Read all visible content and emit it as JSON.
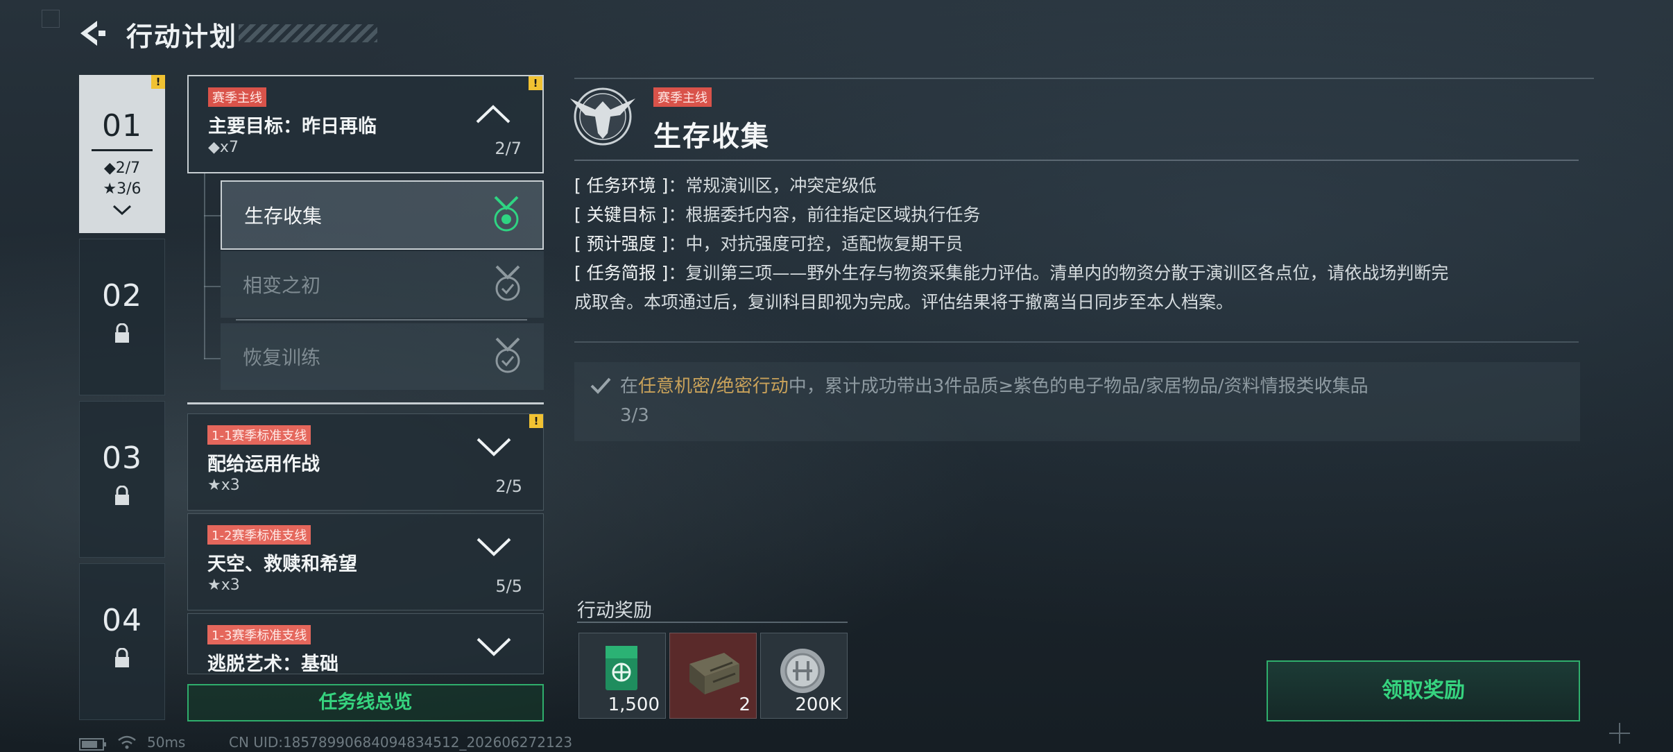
{
  "header": {
    "title": "行动计划"
  },
  "chapters": [
    {
      "num": "01",
      "stat1": "◆2/7",
      "stat2": "★3/6",
      "warn": "!"
    },
    {
      "num": "02"
    },
    {
      "num": "03"
    },
    {
      "num": "04"
    }
  ],
  "missions": {
    "main": {
      "tag": "赛季主线",
      "name": "主要目标：昨日再临",
      "reward": "◆x7",
      "progress": "2/7",
      "warn": "!"
    },
    "subs": [
      {
        "label": "生存收集"
      },
      {
        "label": "相变之初"
      },
      {
        "label": "恢复训练"
      }
    ],
    "branches": [
      {
        "tag": "1-1赛季标准支线",
        "name": "配给运用作战",
        "reward": "★x3",
        "progress": "2/5",
        "warn": "!"
      },
      {
        "tag": "1-2赛季标准支线",
        "name": "天空、救赎和希望",
        "reward": "★x3",
        "progress": "5/5"
      },
      {
        "tag": "1-3赛季标准支线",
        "name": "逃脱艺术：基础"
      }
    ],
    "overview_button": "任务线总览"
  },
  "detail": {
    "tag": "赛季主线",
    "title": "生存收集",
    "info": [
      {
        "key": "[ 任务环境 ]",
        "sep": "：",
        "value": "常规演训区，冲突定级低"
      },
      {
        "key": "[ 关键目标 ]",
        "sep": "：",
        "value": "根据委托内容，前往指定区域执行任务"
      },
      {
        "key": "[ 预计强度 ]",
        "sep": "：",
        "value": "中，对抗强度可控，适配恢复期干员"
      },
      {
        "key": "[ 任务简报 ]",
        "sep": "：",
        "value": "复训第三项——野外生存与物资采集能力评估。清单内的物资分散于演训区各点位，请依战场判断完"
      },
      {
        "key": "",
        "sep": "",
        "value": "成取舍。本项通过后，复训科目即视为完成。评估结果将于撤离当日同步至本人档案。"
      }
    ],
    "objective": {
      "prefix": "在",
      "highlight": "任意机密/绝密行动",
      "suffix": "中，累计成功带出3件品质≥紫色的电子物品/家居物品/资料情报类收集品",
      "count": "3/3"
    }
  },
  "rewards": {
    "title": "行动奖励",
    "items": [
      {
        "icon": "green-card-icon",
        "amount": "1,500"
      },
      {
        "icon": "ammo-crate-icon",
        "amount": "2"
      },
      {
        "icon": "silver-coin-icon",
        "amount": "200K"
      }
    ],
    "claim_button": "领取奖励"
  },
  "status": {
    "ping": "50ms",
    "uid": "CN UID:18578990684094834512_202606272123"
  },
  "colors": {
    "accent_green": "#36d47f",
    "tag_red": "#d9534a",
    "gold": "#c9a25a",
    "warn_yellow": "#f1c232"
  }
}
